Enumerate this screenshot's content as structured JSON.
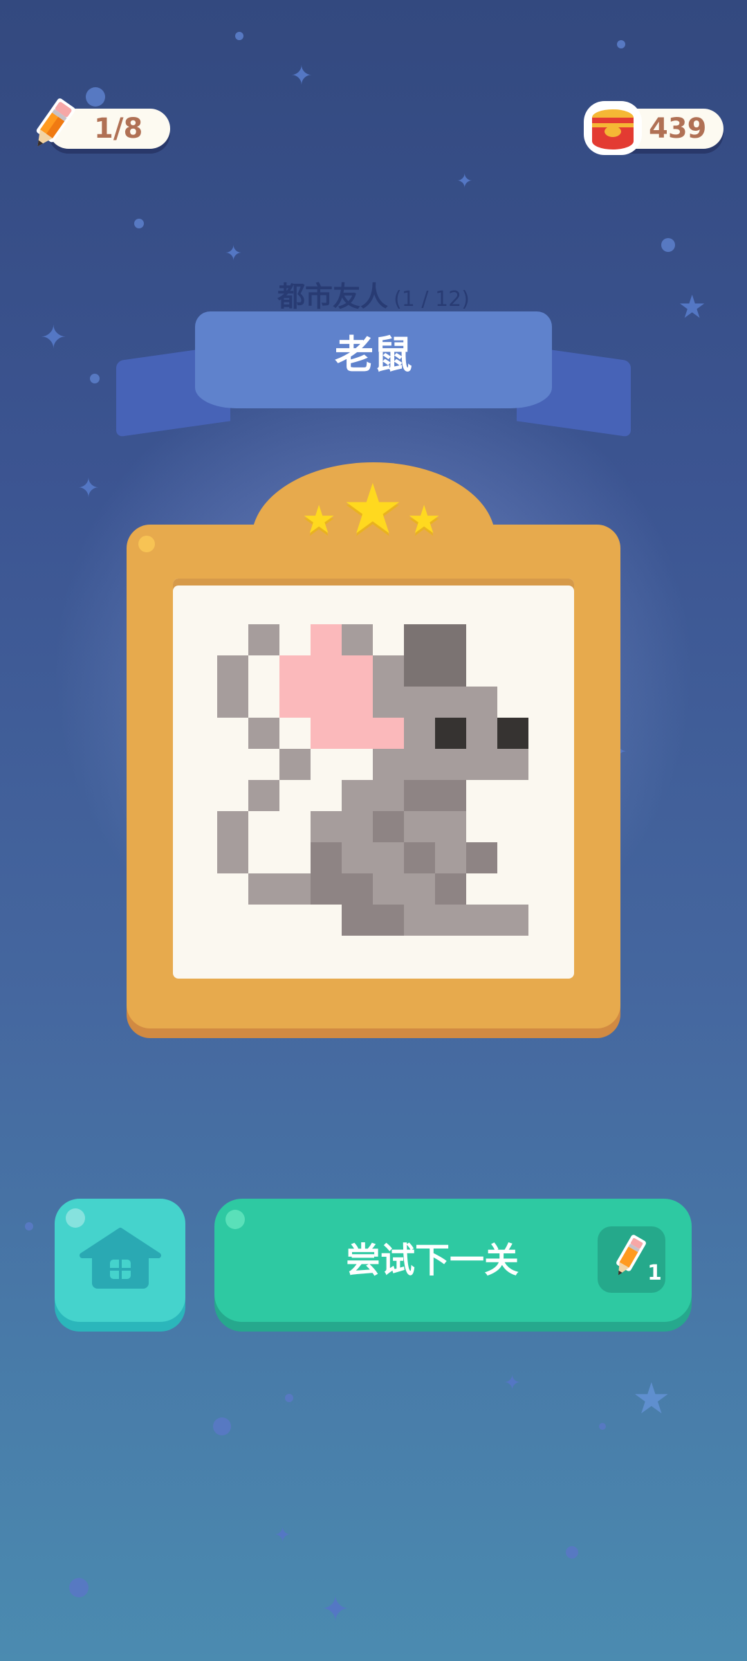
{
  "hud": {
    "pencil_count": "1/8",
    "coins": "439"
  },
  "level": {
    "category": "都市友人",
    "progress": "(1 / 12)",
    "title": "老鼠",
    "stars_earned": 3,
    "stars_total": 3
  },
  "actions": {
    "home_icon": "house-icon",
    "next_label": "尝试下一关",
    "next_cost": "1"
  },
  "colors": {
    "frame": "#e7aa4d",
    "next_button": "#2ec9a2",
    "home_button": "#45d3cc",
    "ribbon": "#5f82cc"
  },
  "pixel_art": {
    "palette": {
      "L": "#a69d9c",
      "M": "#8e8484",
      "D": "#7b7372",
      "E": "#363331",
      "P": "#fbb9bb"
    },
    "rows": [
      ".L.PL.DD.",
      "L.PPPLDD.",
      "L.PPPLLLL.",
      ".L.PPPLELE",
      "..L..LLLLL",
      ".L..LLMM.",
      "L..LLMLL.",
      "L..MLLMLM",
      ".LLMMLLM.",
      "....MMLLLL"
    ]
  }
}
